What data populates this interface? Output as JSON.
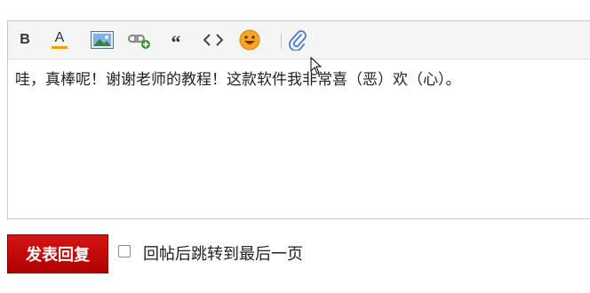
{
  "toolbar": {
    "buttons": [
      {
        "name": "bold",
        "icon": "bold-icon"
      },
      {
        "name": "font-color",
        "icon": "font-color-icon"
      },
      {
        "name": "image",
        "icon": "image-icon"
      },
      {
        "name": "add-link",
        "icon": "link-add-icon"
      },
      {
        "name": "quote",
        "icon": "quote-icon"
      },
      {
        "name": "code",
        "icon": "code-icon"
      },
      {
        "name": "emoji",
        "icon": "smiley-icon"
      },
      {
        "name": "attachment",
        "icon": "paperclip-icon"
      }
    ],
    "bold_glyph": "B",
    "font_color_glyph": "A",
    "quote_glyph": "“",
    "code_glyph": "<>"
  },
  "editor": {
    "content": "哇，真棒呢！谢谢老师的教程！这款软件我非常喜（恶）欢（心）。"
  },
  "footer": {
    "submit_label": "发表回复",
    "checkbox_label": "回帖后跳转到最后一页",
    "checkbox_checked": false
  },
  "colors": {
    "submit_bg": "#c40a0a",
    "font_color_bar": "#f5a000",
    "emoji": "#f5a623"
  }
}
